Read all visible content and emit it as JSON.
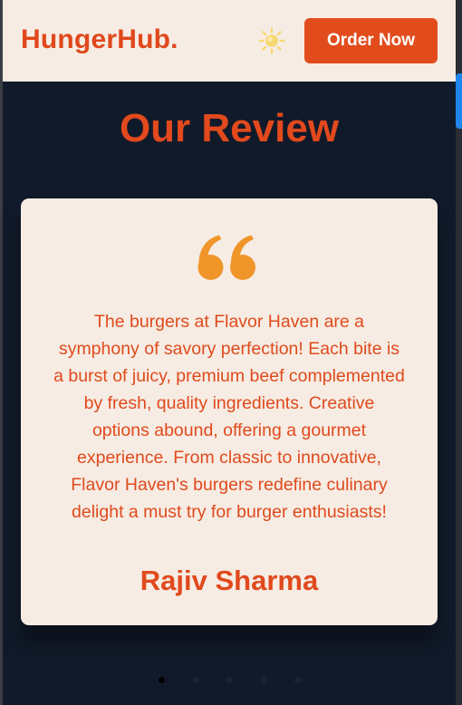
{
  "header": {
    "brand": "HungerHub.",
    "theme_icon": "sun-icon",
    "order_label": "Order Now"
  },
  "reviews": {
    "title": "Our Review",
    "quote_icon": "quote-icon",
    "text": "The burgers at Flavor Haven are a symphony of savory perfection! Each bite is a burst of juicy, premium beef complemented by fresh, quality ingredients. Creative options abound, offering a gourmet experience. From classic to innovative, Flavor Haven's burgers redefine culinary delight a must try for burger enthusiasts!",
    "reviewer": "Rajiv Sharma",
    "slide_count": 5,
    "active_slide": 1
  },
  "colors": {
    "accent": "#e2491c",
    "header_bg": "#f6ece3",
    "section_bg": "#111a2a",
    "quote": "#f0952a",
    "sun": "#f5d76e"
  }
}
